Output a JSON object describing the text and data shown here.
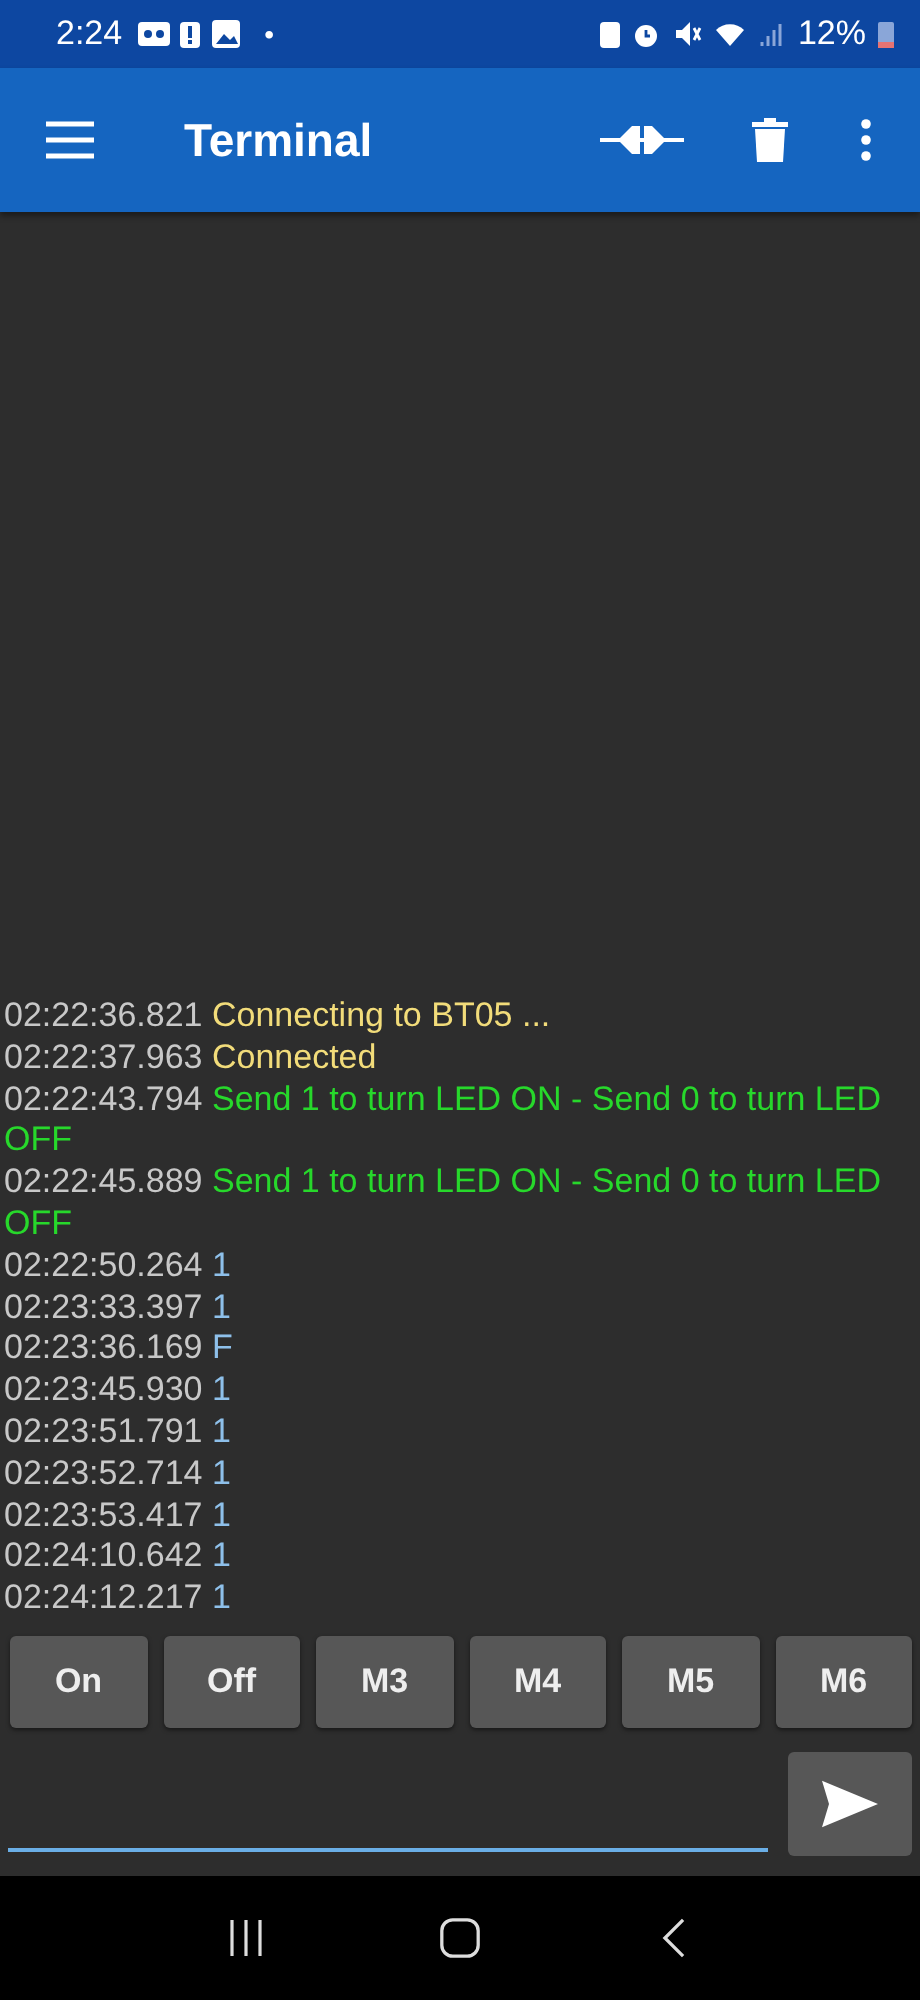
{
  "status_bar": {
    "time": "2:24",
    "dot": "•",
    "battery": "12%"
  },
  "app_bar": {
    "title": "Terminal"
  },
  "log": [
    {
      "time": "02:22:36.821",
      "text": "Connecting to BT05 ...",
      "kind": "status"
    },
    {
      "time": "02:22:37.963",
      "text": "Connected",
      "kind": "status"
    },
    {
      "time": "02:22:43.794",
      "text": "Send 1 to turn LED ON - Send 0 to turn LED OFF",
      "kind": "info"
    },
    {
      "time": "02:22:45.889",
      "text": "Send 1 to turn LED ON - Send 0 to turn LED OFF",
      "kind": "info"
    },
    {
      "time": "02:22:50.264",
      "text": "1",
      "kind": "received"
    },
    {
      "time": "02:23:33.397",
      "text": "1",
      "kind": "received"
    },
    {
      "time": "02:23:36.169",
      "text": "F",
      "kind": "received"
    },
    {
      "time": "02:23:45.930",
      "text": "1",
      "kind": "received"
    },
    {
      "time": "02:23:51.791",
      "text": "1",
      "kind": "received"
    },
    {
      "time": "02:23:52.714",
      "text": "1",
      "kind": "received"
    },
    {
      "time": "02:23:53.417",
      "text": "1",
      "kind": "received"
    },
    {
      "time": "02:24:10.642",
      "text": "1",
      "kind": "received"
    },
    {
      "time": "02:24:12.217",
      "text": "1",
      "kind": "received"
    }
  ],
  "macro_buttons": [
    "On",
    "Off",
    "M3",
    "M4",
    "M5",
    "M6"
  ]
}
